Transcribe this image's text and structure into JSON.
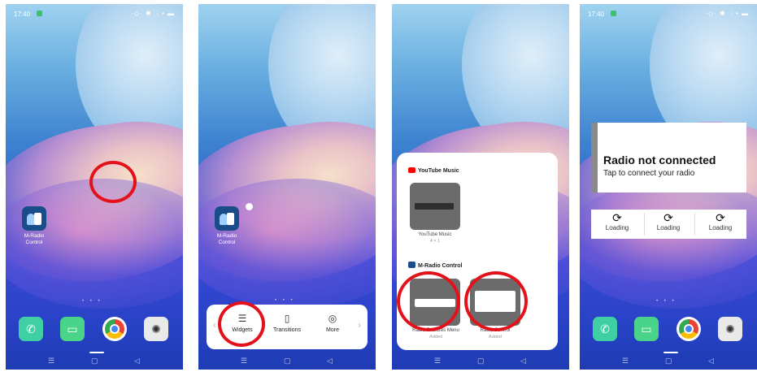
{
  "status_bar": {
    "time": "17:40",
    "icons": "·◇· ✱ ⋮• ▬"
  },
  "home_app": {
    "label": "M-Radio Control",
    "icon": "m-radio-app-icon"
  },
  "dock_apps": [
    "phone-icon",
    "messages-icon",
    "chrome-icon",
    "camera-icon"
  ],
  "page_dots": "• • •",
  "nav_bar": {
    "menu": "☰",
    "home": "▢",
    "back": "◁"
  },
  "edit_menu": {
    "items": [
      {
        "label": "Widgets",
        "icon": "widgets-icon"
      },
      {
        "label": "Transitions",
        "icon": "transitions-icon"
      },
      {
        "label": "More",
        "icon": "more-icon"
      }
    ],
    "left_arrow": "‹",
    "right_arrow": "›"
  },
  "widget_picker": {
    "sections": [
      {
        "title": "YouTube Music",
        "widgets": [
          {
            "name": "YouTube Music",
            "sub": "4 × 1"
          }
        ]
      },
      {
        "title": "M-Radio Control",
        "widgets": [
          {
            "name": "Radio Features Menu",
            "sub": "Added"
          },
          {
            "name": "Radio Control",
            "sub": "Added"
          }
        ]
      }
    ]
  },
  "radio_widget": {
    "title": "Radio not connected",
    "subtitle": "Tap to connect your radio",
    "loading_items": [
      "Loading",
      "Loading",
      "Loading"
    ]
  },
  "colors": {
    "highlight_circle": "#e4111b",
    "card_bar": "#8a8a8a"
  }
}
